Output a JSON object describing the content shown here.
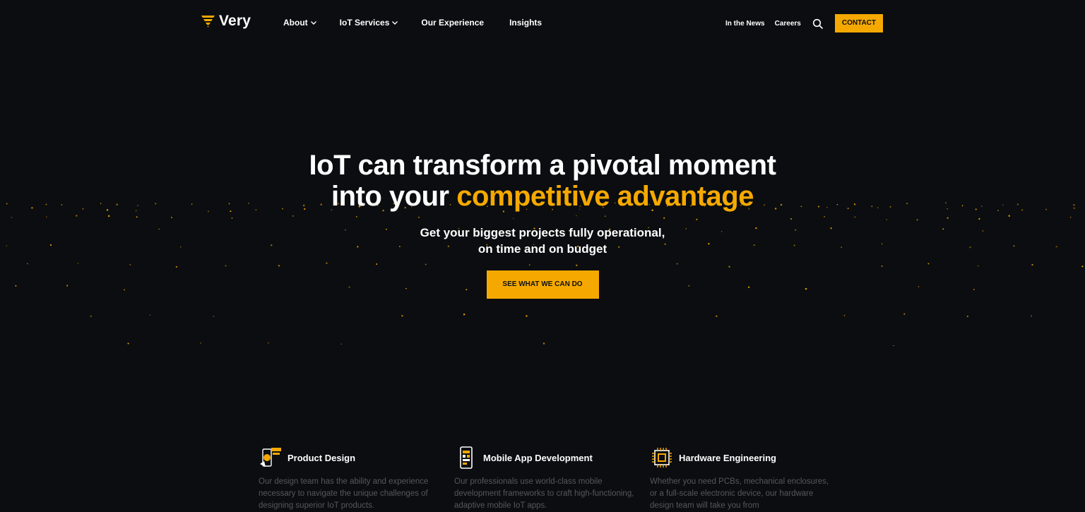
{
  "brand": {
    "name": "Very",
    "accent_color": "#f5a900",
    "background_color": "#0b0d10"
  },
  "nav": {
    "items": [
      {
        "label": "About",
        "has_dropdown": true
      },
      {
        "label": "IoT Services",
        "has_dropdown": true
      },
      {
        "label": "Our Experience",
        "has_dropdown": false
      },
      {
        "label": "Insights",
        "has_dropdown": false
      }
    ],
    "secondary": [
      {
        "label": "In the News"
      },
      {
        "label": "Careers"
      }
    ],
    "search_icon": "search-icon",
    "contact_label": "CONTACT"
  },
  "hero": {
    "title_line1": "IoT can transform a pivotal moment",
    "title_line2_prefix": "into your ",
    "title_line2_accent": "competitive advantage",
    "subtitle_line1": "Get your biggest projects fully operational,",
    "subtitle_line2": "on time and on budget",
    "cta_label": "SEE WHAT WE CAN DO"
  },
  "features": [
    {
      "title": "Product Design",
      "icon": "product-design-icon",
      "description": "Our design team has the ability and experience necessary to navigate the unique challenges of designing superior IoT products."
    },
    {
      "title": "Mobile App Development",
      "icon": "mobile-app-icon",
      "description": "Our professionals use world-class mobile development frameworks to craft high-functioning, adaptive mobile IoT apps."
    },
    {
      "title": "Hardware Engineering",
      "icon": "chip-icon",
      "description": "Whether you need PCBs, mechanical enclosures, or a full-scale electronic device, our hardware design team will take you from"
    }
  ]
}
